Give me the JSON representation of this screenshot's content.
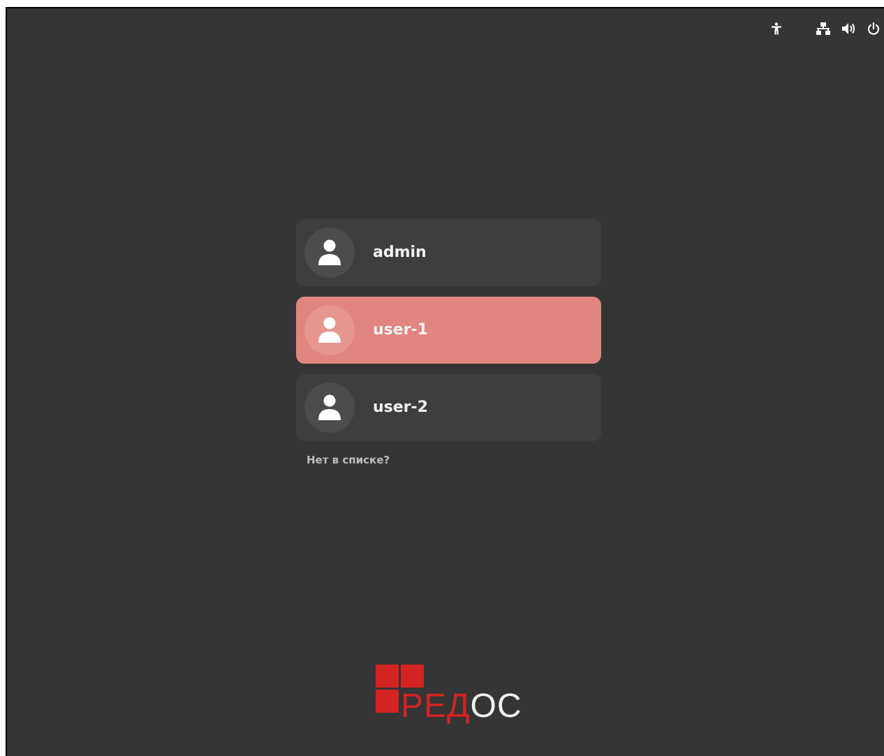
{
  "topbar": {
    "accessibility_icon": "accessibility-icon",
    "network_icon": "network-icon",
    "volume_icon": "volume-icon",
    "power_icon": "power-icon"
  },
  "users": [
    {
      "name": "admin",
      "selected": false
    },
    {
      "name": "user-1",
      "selected": true
    },
    {
      "name": "user-2",
      "selected": false
    }
  ],
  "not_listed_label": "Нет в списке?",
  "logo": {
    "text_red": "РЕД",
    "text_white": "ОС"
  },
  "colors": {
    "background": "#353535",
    "selected": "#e0857f",
    "brand_red": "#d42323"
  }
}
